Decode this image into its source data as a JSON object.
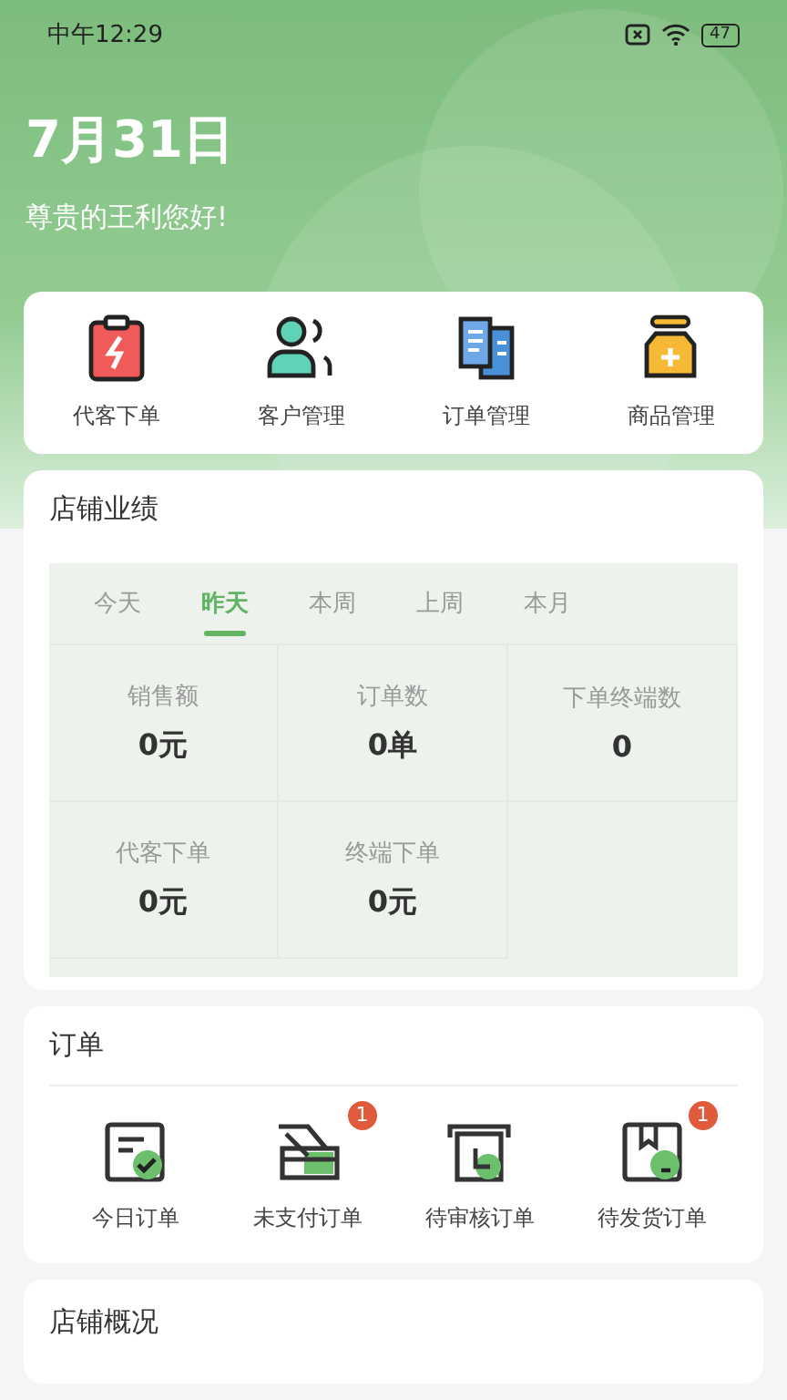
{
  "status_bar": {
    "time": "中午12:29",
    "battery": "47"
  },
  "header": {
    "date": "7月31日",
    "greeting": "尊贵的王利您好!"
  },
  "shortcuts": [
    {
      "label": "代客下单"
    },
    {
      "label": "客户管理"
    },
    {
      "label": "订单管理"
    },
    {
      "label": "商品管理"
    }
  ],
  "performance": {
    "title": "店铺业绩",
    "tabs": [
      {
        "label": "今天",
        "selected": false
      },
      {
        "label": "昨天",
        "selected": true
      },
      {
        "label": "本周",
        "selected": false
      },
      {
        "label": "上周",
        "selected": false
      },
      {
        "label": "本月",
        "selected": false
      }
    ],
    "metrics": [
      {
        "label": "销售额",
        "value": "0元"
      },
      {
        "label": "订单数",
        "value": "0单"
      },
      {
        "label": "下单终端数",
        "value": "0"
      },
      {
        "label": "代客下单",
        "value": "0元"
      },
      {
        "label": "终端下单",
        "value": "0元"
      }
    ]
  },
  "orders": {
    "title": "订单",
    "items": [
      {
        "label": "今日订单"
      },
      {
        "label": "未支付订单",
        "badge": "1"
      },
      {
        "label": "待审核订单"
      },
      {
        "label": "待发货订单",
        "badge": "1"
      }
    ]
  },
  "overview": {
    "title": "店铺概况"
  }
}
